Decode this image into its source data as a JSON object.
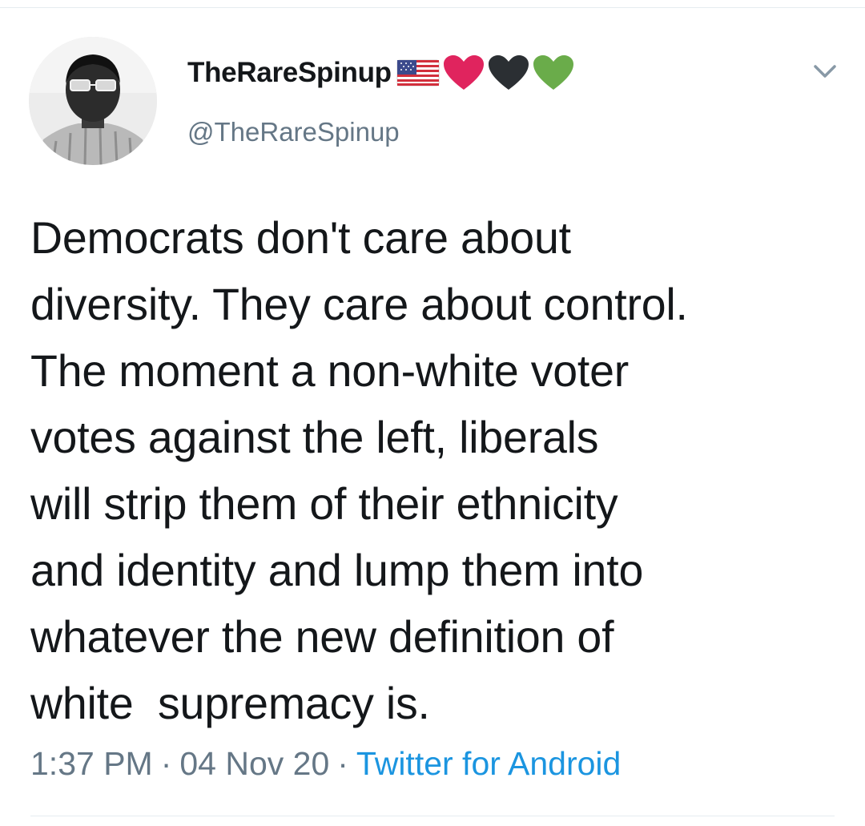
{
  "tweet": {
    "author": {
      "display_name": "TheRareSpinup",
      "handle": "@TheRareSpinup",
      "name_icons": [
        "us-flag-icon",
        "red-heart-icon",
        "black-heart-icon",
        "green-heart-icon"
      ],
      "icon_colors": {
        "red_heart": "#e0245e",
        "black_heart": "#2b2f33",
        "green_heart": "#6aac4a"
      }
    },
    "text": "Democrats don't care about\ndiversity. They care about control.\nThe moment a non-white voter\nvotes against the left, liberals\nwill strip them of their ethnicity\nand identity and lump them into\nwhatever the new definition of\nwhite  supremacy is.",
    "meta": {
      "time": "1:37 PM",
      "separator": "·",
      "date": "04 Nov 20",
      "source": "Twitter for Android"
    }
  },
  "colors": {
    "text": "#14171a",
    "secondary": "#657786",
    "link": "#1b95e0",
    "divider": "#e6ecf0"
  }
}
